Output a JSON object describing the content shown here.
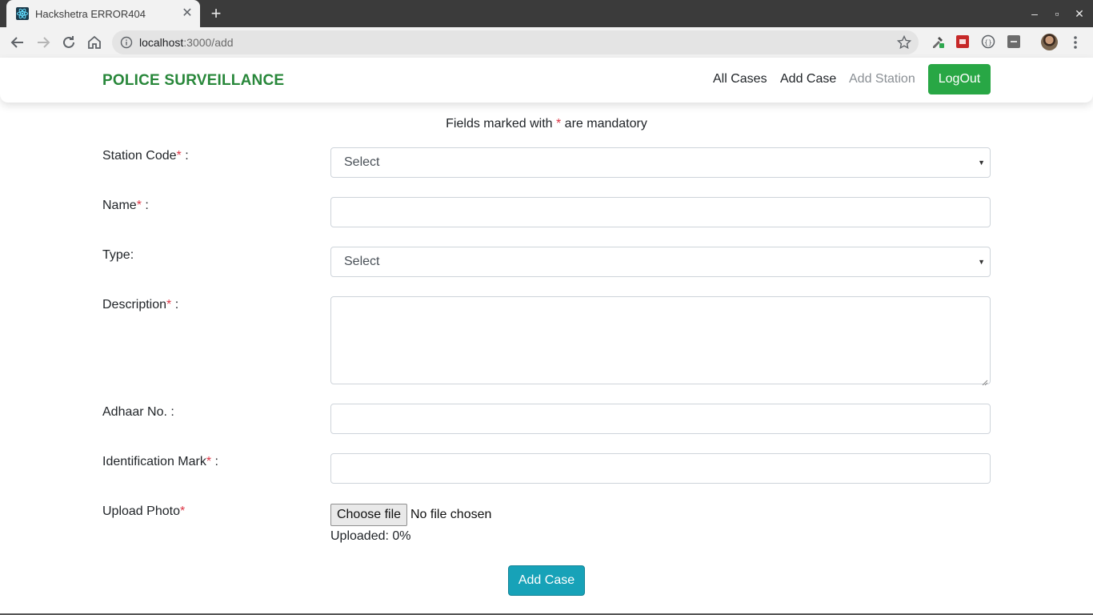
{
  "browser": {
    "tab_title": "Hackshetra ERROR404",
    "tab_close": "✕",
    "new_tab": "+",
    "url_host": "localhost",
    "url_path": ":3000/add",
    "window_controls": {
      "minimize": "–",
      "maximize": "▫",
      "close": "✕"
    }
  },
  "navbar": {
    "brand": "POLICE SURVEILLANCE",
    "links": [
      "All Cases",
      "Add Case",
      "Add Station"
    ],
    "logout": "LogOut",
    "colors": {
      "brand": "#28873a",
      "logout_bg": "#28a745"
    }
  },
  "form": {
    "note_prefix": "Fields marked with ",
    "note_star": "*",
    "note_suffix": " are mandatory",
    "required_marker": "*",
    "fields": {
      "station_code": {
        "label": "Station Code",
        "suffix": " :",
        "value": "Select"
      },
      "name": {
        "label": "Name",
        "suffix": " :",
        "value": ""
      },
      "type": {
        "label": "Type:",
        "value": "Select"
      },
      "description": {
        "label": "Description",
        "suffix": " :",
        "value": ""
      },
      "adhaar": {
        "label": "Adhaar No. :",
        "value": ""
      },
      "identification_mark": {
        "label": "Identification Mark",
        "suffix": " :",
        "value": ""
      },
      "upload_photo": {
        "label": "Upload Photo",
        "button": "Choose file",
        "status": "No file chosen"
      }
    },
    "uploaded": "Uploaded: 0%",
    "submit": "Add Case",
    "colors": {
      "required": "#dc3545",
      "submit_bg": "#17a2b8"
    }
  }
}
